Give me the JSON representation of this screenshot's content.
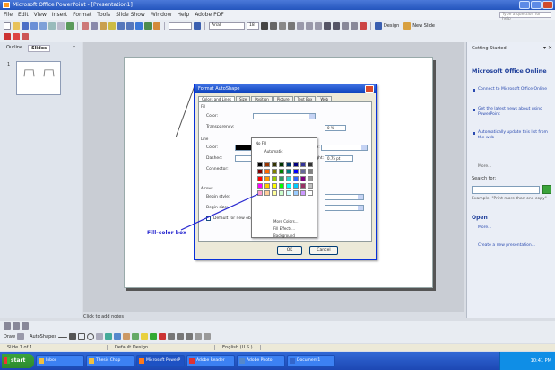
{
  "window": {
    "title": "Microsoft Office PowerPoint - [Presentation1]"
  },
  "menubar": {
    "items": [
      "File",
      "Edit",
      "View",
      "Insert",
      "Format",
      "Tools",
      "Slide Show",
      "Window",
      "Help",
      "Adobe PDF"
    ],
    "help_placeholder": "Type a question for help"
  },
  "toolbar": {
    "font_name": "Arial",
    "font_size": "18",
    "design_label": "Design",
    "new_slide_label": "New Slide"
  },
  "left_pane": {
    "tab_outline": "Outline",
    "tab_slides": "Slides",
    "close": "x",
    "slide_number": "1"
  },
  "dialog": {
    "title": "Format AutoShape",
    "tabs": [
      "Colors and Lines",
      "Size",
      "Position",
      "Picture",
      "Text Box",
      "Web"
    ],
    "fill_group": "Fill",
    "fill_color_label": "Color:",
    "transparency_label": "Transparency:",
    "line_group": "Line",
    "line_color_label": "Color:",
    "dashed_label": "Dashed:",
    "connector_label": "Connector:",
    "arrows_group": "Arrows",
    "begin_style_label": "Begin style:",
    "begin_size_label": "Begin size:",
    "style_label": "Style:",
    "weight_label": "Weight:",
    "weight_value": "0.75 pt",
    "transparency_value": "0 %",
    "default_checkbox_label": "Default for new objects",
    "ok_label": "OK",
    "cancel_label": "Cancel"
  },
  "color_popup": {
    "no_fill": "No Fill",
    "automatic": "Automatic",
    "more_colors": "More Colors...",
    "fill_effects": "Fill Effects...",
    "background": "Background",
    "palette": [
      "#000000",
      "#993300",
      "#333300",
      "#003300",
      "#003366",
      "#000080",
      "#333399",
      "#333333",
      "#800000",
      "#FF6600",
      "#808000",
      "#008000",
      "#008080",
      "#0000FF",
      "#666699",
      "#808080",
      "#FF0000",
      "#FF9900",
      "#99CC00",
      "#339966",
      "#33CCCC",
      "#3366FF",
      "#800080",
      "#969696",
      "#FF00FF",
      "#FFCC00",
      "#FFFF00",
      "#00FF00",
      "#00FFFF",
      "#00CCFF",
      "#993366",
      "#C0C0C0",
      "#FF99CC",
      "#FFCC99",
      "#FFFF99",
      "#CCFFCC",
      "#CCFFFF",
      "#99CCFF",
      "#CC99FF",
      "#FFFFFF"
    ]
  },
  "annotation": {
    "label": "Fill-color box"
  },
  "task_pane": {
    "title": "Getting Started",
    "heading": "Microsoft Office Online",
    "links": [
      "Connect to Microsoft Office Online",
      "Get the latest news about using PowerPoint",
      "Automatically update this list from the web"
    ],
    "more": "More...",
    "search_label": "Search for:",
    "example": "Example: \"Print more than one copy\"",
    "open_heading": "Open",
    "more_files": "More...",
    "create_new": "Create a new presentation..."
  },
  "notes": {
    "hint": "Click to add notes"
  },
  "bottom": {
    "draw_label": "Draw",
    "autoshapes_label": "AutoShapes"
  },
  "status": {
    "slide": "Slide 1 of 1",
    "design": "Default Design",
    "language": "English (U.S.)"
  },
  "taskbar": {
    "start": "start",
    "buttons": [
      "Inbox",
      "Thesis Chap",
      "Microsoft PowerP",
      "Adobe Reader",
      "Adobe Photo",
      "Document1"
    ],
    "clock": "10:41 PM"
  },
  "colors": {
    "title_bar": "#2455bd",
    "annotation": "#2a2ad0",
    "task_pane_link": "#2a4ab0"
  }
}
